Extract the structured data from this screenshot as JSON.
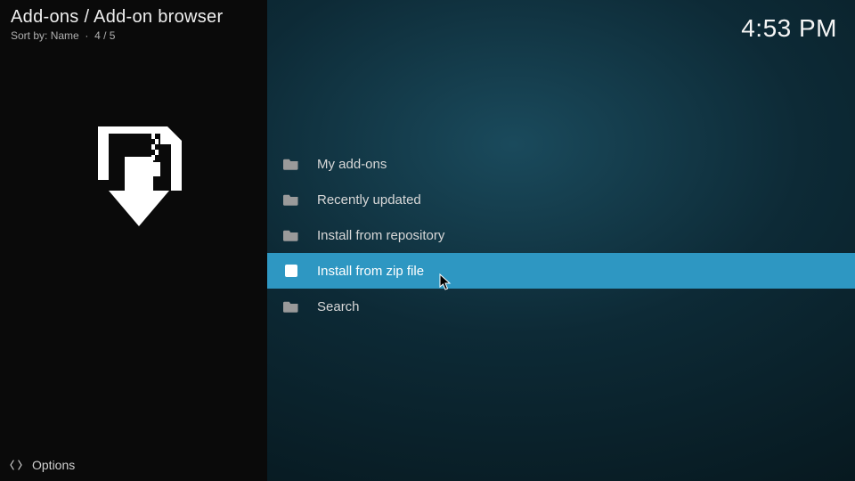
{
  "header": {
    "breadcrumb": "Add-ons / Add-on browser",
    "sort_label": "Sort by:",
    "sort_value": "Name",
    "position": "4 / 5"
  },
  "clock": "4:53 PM",
  "menu": {
    "items": [
      {
        "label": "My add-ons",
        "icon": "folder",
        "selected": false
      },
      {
        "label": "Recently updated",
        "icon": "folder",
        "selected": false
      },
      {
        "label": "Install from repository",
        "icon": "folder",
        "selected": false
      },
      {
        "label": "Install from zip file",
        "icon": "zip",
        "selected": true
      },
      {
        "label": "Search",
        "icon": "folder",
        "selected": false
      }
    ]
  },
  "footer": {
    "options_label": "Options"
  }
}
